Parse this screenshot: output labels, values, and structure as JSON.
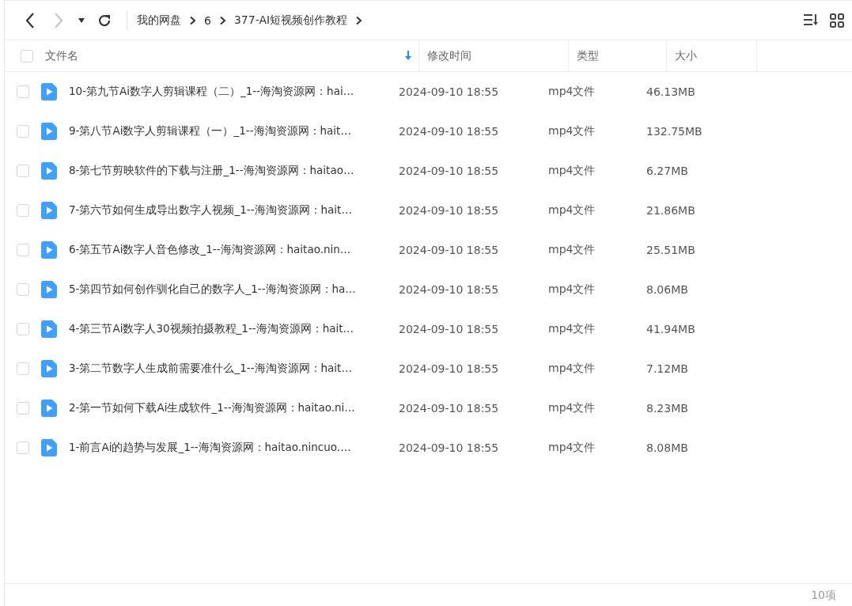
{
  "toolbar": {
    "nav": [
      {
        "kind": "back",
        "disabled": false
      },
      {
        "kind": "forward",
        "disabled": true
      },
      {
        "kind": "history",
        "disabled": false
      },
      {
        "kind": "refresh",
        "disabled": false
      }
    ],
    "breadcrumb": [
      "我的网盘",
      "6",
      "377-AI短视频创作教程"
    ]
  },
  "table": {
    "select_all": {
      "checked": false
    },
    "columns": [
      {
        "label": "文件名",
        "sorted": true
      },
      {
        "label": "修改时间",
        "sorted": false
      },
      {
        "label": "类型",
        "sorted": false
      },
      {
        "label": "大小",
        "sorted": false
      }
    ],
    "rows": [
      {
        "checked": false,
        "name": "10-第九节Ai数字人剪辑课程（二）_1--海淘资源网：hai…",
        "modified": "2024-09-10 18:55",
        "type": "mp4文件",
        "size": "46.13MB"
      },
      {
        "checked": false,
        "name": "9-第八节Ai数字人剪辑课程（一）_1--海淘资源网：hait…",
        "modified": "2024-09-10 18:55",
        "type": "mp4文件",
        "size": "132.75MB"
      },
      {
        "checked": false,
        "name": "8-第七节剪映软件的下载与注册_1--海淘资源网：haitao…",
        "modified": "2024-09-10 18:55",
        "type": "mp4文件",
        "size": "6.27MB"
      },
      {
        "checked": false,
        "name": "7-第六节如何生成导出数字人视频_1--海淘资源网：hait…",
        "modified": "2024-09-10 18:55",
        "type": "mp4文件",
        "size": "21.86MB"
      },
      {
        "checked": false,
        "name": "6-第五节Ai数字人音色修改_1--海淘资源网：haitao.nin…",
        "modified": "2024-09-10 18:55",
        "type": "mp4文件",
        "size": "25.51MB"
      },
      {
        "checked": false,
        "name": "5-第四节如何创作驯化自己的数字人_1--海淘资源网：ha…",
        "modified": "2024-09-10 18:55",
        "type": "mp4文件",
        "size": "8.06MB"
      },
      {
        "checked": false,
        "name": "4-第三节Ai数字人30视频拍摄教程_1--海淘资源网：hait…",
        "modified": "2024-09-10 18:55",
        "type": "mp4文件",
        "size": "41.94MB"
      },
      {
        "checked": false,
        "name": "3-第二节数字人生成前需要准什么_1--海淘资源网：hait…",
        "modified": "2024-09-10 18:55",
        "type": "mp4文件",
        "size": "7.12MB"
      },
      {
        "checked": false,
        "name": "2-第一节如何下载Ai生成软件_1--海淘资源网：haitao.ni…",
        "modified": "2024-09-10 18:55",
        "type": "mp4文件",
        "size": "8.23MB"
      },
      {
        "checked": false,
        "name": "1-前言Ai的趋势与发展_1--海淘资源网：haitao.nincuo.…",
        "modified": "2024-09-10 18:55",
        "type": "mp4文件",
        "size": "8.08MB"
      }
    ]
  },
  "status_bar": {
    "count": "10项"
  }
}
